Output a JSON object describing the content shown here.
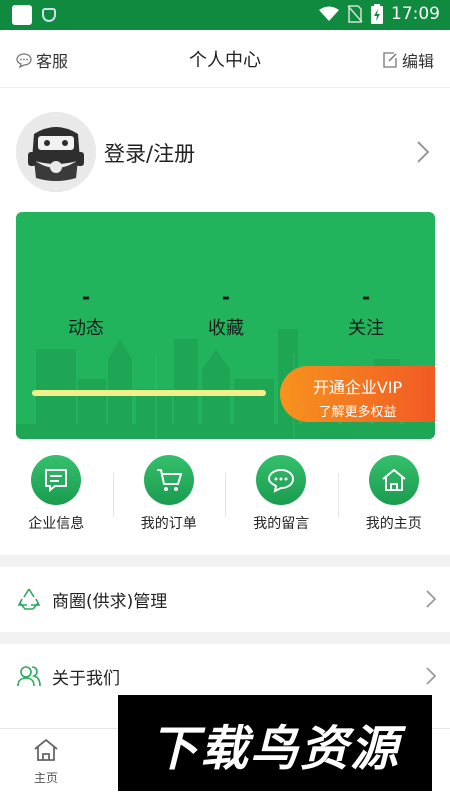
{
  "status_bar": {
    "time": "17:09",
    "icons": [
      "app-icon",
      "shield-icon",
      "wifi-icon",
      "no-sim-icon",
      "battery-icon"
    ]
  },
  "header": {
    "left_label": "客服",
    "title": "个人中心",
    "right_label": "编辑"
  },
  "profile": {
    "login_label": "登录/注册"
  },
  "card": {
    "stats": [
      {
        "value": "-",
        "label": "动态"
      },
      {
        "value": "-",
        "label": "收藏"
      },
      {
        "value": "-",
        "label": "关注"
      }
    ],
    "vip": {
      "title": "开通企业VIP",
      "subtitle": "了解更多权益"
    },
    "progress": 1.0
  },
  "actions": [
    {
      "label": "企业信息",
      "icon": "document-icon"
    },
    {
      "label": "我的订单",
      "icon": "cart-icon"
    },
    {
      "label": "我的留言",
      "icon": "chat-icon"
    },
    {
      "label": "我的主页",
      "icon": "home-icon"
    }
  ],
  "list": [
    {
      "label": "商圈(供求)管理",
      "icon": "recycle-icon"
    },
    {
      "label": "关于我们",
      "icon": "users-icon"
    }
  ],
  "bottom_nav": {
    "home_label": "主页"
  },
  "watermark": {
    "text": "下载鸟资源"
  },
  "colors": {
    "brand_green": "#22b45d",
    "status_bar": "#0f8a3e",
    "vip_orange": "#f15a24"
  }
}
